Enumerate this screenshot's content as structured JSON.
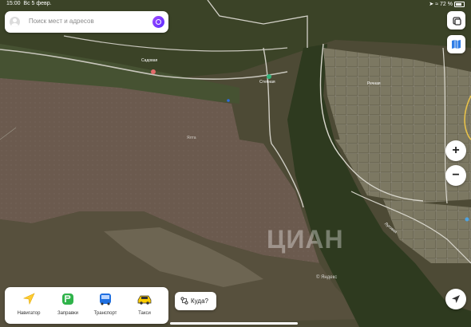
{
  "status_bar": {
    "time": "15:00",
    "date": "Вс 5 февр.",
    "battery": "72 %"
  },
  "search": {
    "placeholder": "Поиск мест и адресов"
  },
  "map": {
    "labels": [
      {
        "name": "street-label",
        "text": "Садовая"
      },
      {
        "name": "street-label",
        "text": "Степная"
      },
      {
        "name": "street-label",
        "text": "Речная"
      },
      {
        "name": "street-label",
        "text": "Луговая"
      },
      {
        "name": "field-label",
        "text": "Ялта"
      }
    ],
    "watermark": "ЦИАН",
    "copyright": "© Яндекс"
  },
  "controls": {
    "zoom_in": "+",
    "zoom_out": "−"
  },
  "services": [
    {
      "label": "Навигатор",
      "icon": "navigator-icon",
      "color": "#ffcc33"
    },
    {
      "label": "Заправки",
      "icon": "fuel-icon",
      "color": "#2fb34a"
    },
    {
      "label": "Транспорт",
      "icon": "bus-icon",
      "color": "#1f6fe0"
    },
    {
      "label": "Такси",
      "icon": "taxi-icon",
      "color": "#ffcc00"
    }
  ],
  "where_button": {
    "label": "Куда?"
  }
}
